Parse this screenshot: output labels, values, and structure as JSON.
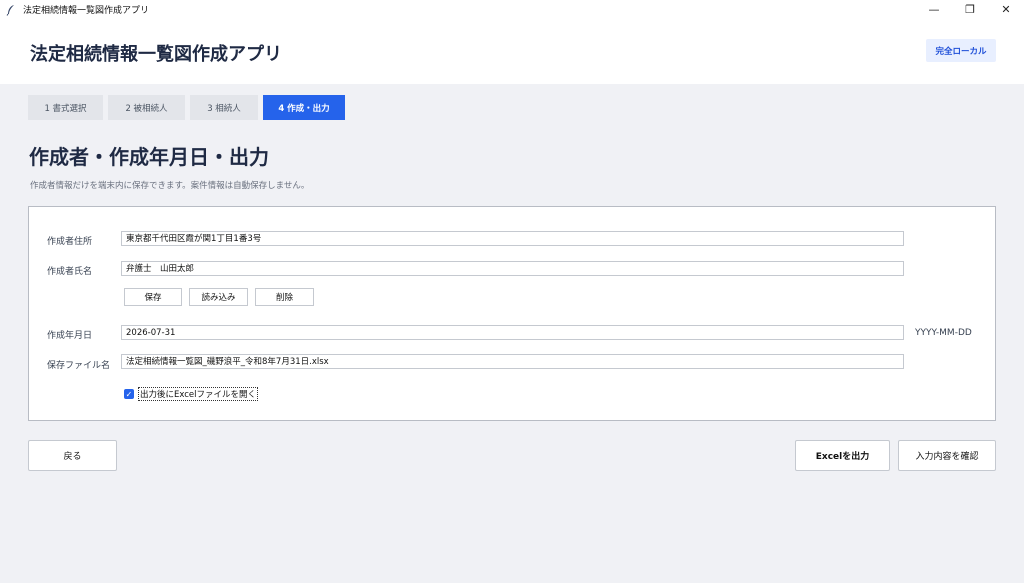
{
  "window": {
    "title": "法定相続情報一覧図作成アプリ",
    "controls": {
      "minimize": "—",
      "maximize": "❐",
      "close": "✕"
    }
  },
  "header": {
    "app_title": "法定相続情報一覧図作成アプリ",
    "badge": "完全ローカル"
  },
  "tabs": [
    {
      "label": "1  書式選択",
      "active": false
    },
    {
      "label": "2  被相続人",
      "active": false
    },
    {
      "label": "3  相続人",
      "active": false
    },
    {
      "label": "4  作成・出力",
      "active": true
    }
  ],
  "page": {
    "title": "作成者・作成年月日・出力",
    "subtitle": "作成者情報だけを端末内に保存できます。案件情報は自動保存しません。"
  },
  "form": {
    "address_label": "作成者住所",
    "address_value": "東京都千代田区霞が関1丁目1番3号",
    "name_label": "作成者氏名",
    "name_value": "弁護士　山田太郎",
    "save_button": "保存",
    "load_button": "読み込み",
    "delete_button": "削除",
    "date_label": "作成年月日",
    "date_value": "2026-07-31",
    "date_hint": "YYYY-MM-DD",
    "filename_label": "保存ファイル名",
    "filename_value": "法定相続情報一覧図_磯野浪平_令和8年7月31日.xlsx",
    "open_after_output_label": "出力後にExcelファイルを開く",
    "open_after_output_checked": true
  },
  "footer": {
    "back_button": "戻る",
    "export_button": "Excelを出力",
    "confirm_button": "入力内容を確認"
  },
  "colors": {
    "accent": "#2563eb",
    "badge_bg": "#e8efff",
    "page_bg": "#f0f1f5"
  }
}
